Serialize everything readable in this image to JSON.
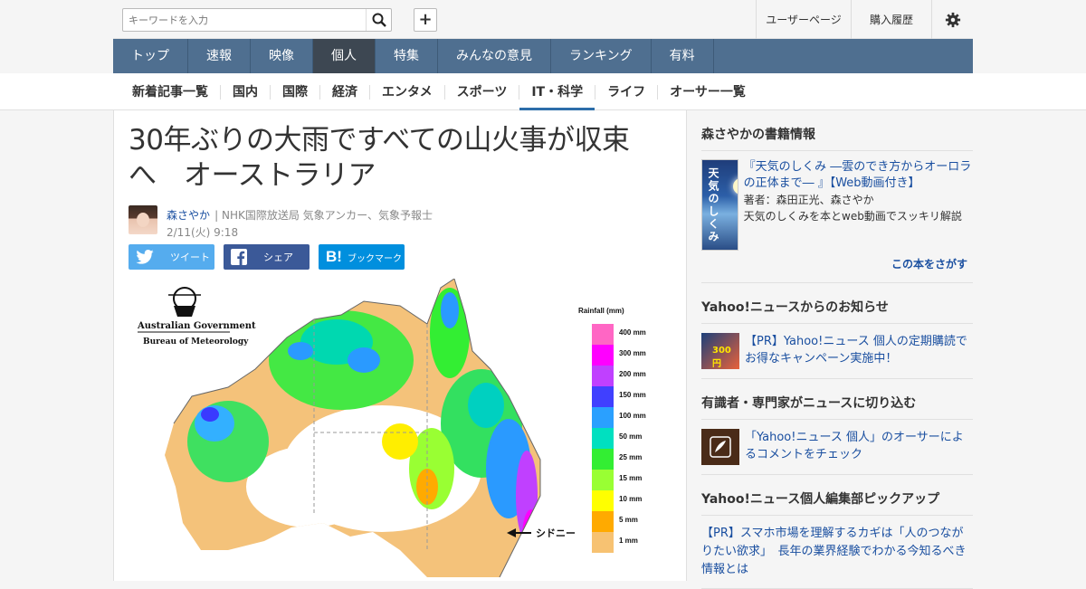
{
  "search": {
    "placeholder": "キーワードを入力"
  },
  "topbar": {
    "add_label": "+",
    "user_page": "ユーザーページ",
    "purchase_history": "購入履歴"
  },
  "nav": {
    "items": [
      {
        "label": "トップ"
      },
      {
        "label": "速報"
      },
      {
        "label": "映像"
      },
      {
        "label": "個人"
      },
      {
        "label": "特集"
      },
      {
        "label": "みんなの意見"
      },
      {
        "label": "ランキング"
      },
      {
        "label": "有料"
      }
    ],
    "active": "個人"
  },
  "subnav": {
    "items": [
      {
        "label": "新着記事一覧"
      },
      {
        "label": "国内"
      },
      {
        "label": "国際"
      },
      {
        "label": "経済"
      },
      {
        "label": "エンタメ"
      },
      {
        "label": "スポーツ"
      },
      {
        "label": "IT・科学"
      },
      {
        "label": "ライフ"
      },
      {
        "label": "オーサー一覧"
      }
    ],
    "active": "IT・科学"
  },
  "article": {
    "title": "30年ぶりの大雨ですべての山火事が収束へ　オーストラリア",
    "author_name": "森さやか",
    "author_role": "| NHK国際放送局 気象アンカー、気象予報士",
    "date": "2/11(火) 9:18",
    "share": {
      "tweet": "ツイート",
      "facebook": "シェア",
      "hatena": "ブックマーク"
    },
    "map": {
      "org1": "Australian Government",
      "org2": "Bureau of Meteorology",
      "legend_title": "Rainfall (mm)",
      "legend": [
        "400 mm",
        "300 mm",
        "200 mm",
        "150 mm",
        "100 mm",
        "50 mm",
        "25 mm",
        "15 mm",
        "10 mm",
        "5 mm",
        "1 mm"
      ],
      "legend_colors": [
        "#ff66c4",
        "#ff00ff",
        "#c040ff",
        "#4040ff",
        "#2aa0ff",
        "#00e0c0",
        "#33ee33",
        "#99ff33",
        "#ffff00",
        "#ffaa00",
        "#f7c272"
      ],
      "callout": "シドニー"
    }
  },
  "sidebar": {
    "book_heading": "森さやかの書籍情報",
    "book_cover_title": "天気のしくみ",
    "book_link": "『天気のしくみ ―雲のでき方からオーロラの正体まで― 』【Web動画付き】",
    "book_authors": "著者：森田正光、森さやか",
    "book_desc": "天気のしくみを本とweb動画でスッキリ解説",
    "book_more": "この本をさがす",
    "notice_heading": "Yahoo!ニュースからのお知らせ",
    "notice_thumb_text": "300円",
    "notice_link": "【PR】Yahoo!ニュース 個人の定期購読でお得なキャンペーン実施中！",
    "expert_heading": "有識者・専門家がニュースに切り込む",
    "expert_link": "「Yahoo!ニュース 個人」のオーサーによるコメントをチェック",
    "pickup_heading": "Yahoo!ニュース個人編集部ピックアップ",
    "pickup_link": "【PR】スマホ市場を理解するカギは「人のつながりたい欲求」　長年の業界経験でわかる今知るべき情報とは"
  }
}
